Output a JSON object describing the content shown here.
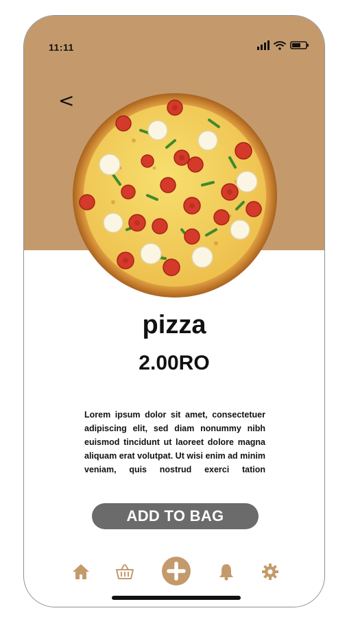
{
  "status_bar": {
    "time": "11:11",
    "icons": [
      "cellular-signal-icon",
      "wifi-icon",
      "battery-icon"
    ]
  },
  "navigation": {
    "back_label": "<"
  },
  "product": {
    "name": "pizza",
    "price": "2.00RO",
    "description": "Lorem ipsum dolor sit amet, consectetuer adipiscing elit, sed diam nonummy nibh euismod tincidunt ut laoreet dolore magna aliquam erat volutpat. Ut wisi enim ad minim veniam, quis nostrud exerci tation ullamcorper",
    "image": "pizza-photo"
  },
  "actions": {
    "add_to_bag_label": "ADD TO BAG"
  },
  "tab_bar": {
    "items": [
      "home-icon",
      "basket-icon",
      "add-icon",
      "bell-icon",
      "gear-icon"
    ]
  },
  "colors": {
    "accent": "#c49a6c",
    "button": "#6b6b6b",
    "text": "#111111"
  }
}
